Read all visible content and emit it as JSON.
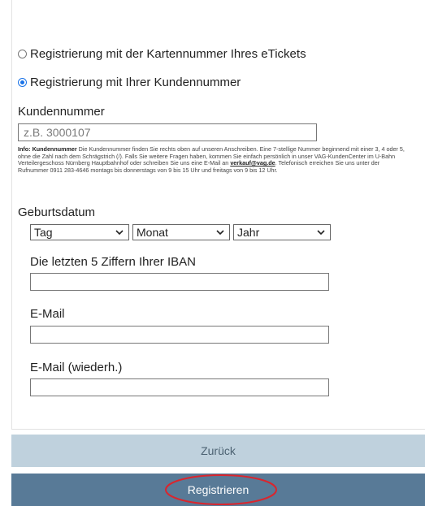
{
  "form": {
    "option_card": {
      "label": "Registrierung mit der Kartennummer Ihres eTickets",
      "selected": false
    },
    "option_customer": {
      "label": "Registrierung mit Ihrer Kundennummer",
      "selected": true
    },
    "customer_number": {
      "label": "Kundennummer",
      "placeholder": "z.B. 3000107",
      "value": ""
    },
    "info": {
      "prefix": "Info:",
      "bold_term": "Kundennummer",
      "text_1": " Die Kundennummer finden Sie rechts oben auf unseren Anschreiben. Eine 7-stellige Nummer beginnend mit einer 3, 4 oder 5, ohne die Zahl nach dem Schrägstrich (/). Falls Sie weitere Fragen haben, kommen Sie einfach persönlich in unser VAG-KundenCenter im U-Bahn Verteilergeschoss Nürnberg Hauptbahnhof oder schreiben Sie uns eine E-Mail an ",
      "email": "verkauf@vag.de",
      "text_2": ". Telefonisch erreichen Sie uns unter der Rufnummer 0911 283-4646 montags bis donnerstags von 9 bis 15 Uhr und freitags von 9 bis 12 Uhr."
    },
    "birthdate": {
      "label": "Geburtsdatum",
      "day": "Tag",
      "month": "Monat",
      "year": "Jahr"
    },
    "iban": {
      "label": "Die letzten 5 Ziffern Ihrer IBAN",
      "value": ""
    },
    "email": {
      "label": "E-Mail",
      "value": ""
    },
    "email_repeat": {
      "label": "E-Mail (wiederh.)",
      "value": ""
    }
  },
  "buttons": {
    "back": "Zurück",
    "register": "Registrieren"
  },
  "colors": {
    "back_button": "#bfd1dd",
    "register_button": "#587a97",
    "highlight": "#d9262e",
    "radio_selected": "#1a73e8"
  }
}
